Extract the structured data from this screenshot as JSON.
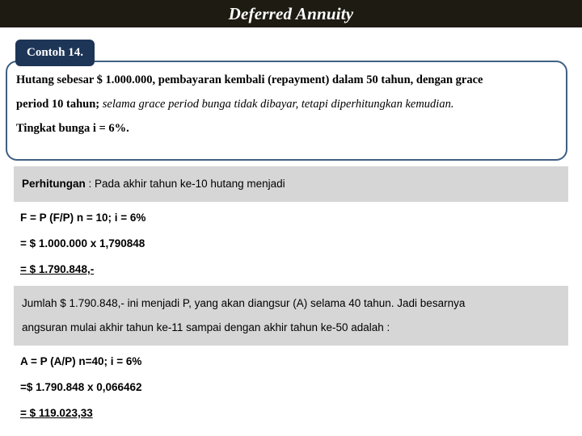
{
  "header": {
    "title": "Deferred Annuity"
  },
  "callout": {
    "tab_label": "Contoh 14.",
    "line1_main": "Hutang sebesar $ 1.000.000, pembayaran kembali (repayment) dalam 50 tahun, dengan grace",
    "line2_bold": "period 10 tahun;",
    "line2_italic": "selama grace period bunga tidak dibayar, tetapi diperhitungkan kemudian.",
    "line3": "Tingkat bunga i = 6%."
  },
  "band1": {
    "label": "Perhitungan",
    "text": " : Pada akhir tahun ke-10 hutang menjadi"
  },
  "formulas1": [
    {
      "text": "F = P (F/P) n = 10; i = 6%",
      "underline": false
    },
    {
      "text": "= $ 1.000.000 x 1,790848",
      "underline": false
    },
    {
      "text": "= $ 1.790.848,-",
      "underline": true
    }
  ],
  "band2": {
    "line1": "Jumlah $ 1.790.848,- ini menjadi P, yang akan diangsur (A) selama 40 tahun. Jadi besarnya",
    "line2": "angsuran mulai akhir tahun ke-11 sampai dengan akhir tahun ke-50 adalah :"
  },
  "formulas2": [
    {
      "text": "A = P (A/P) n=40; i = 6%",
      "underline": false
    },
    {
      "text": "=$ 1.790.848 x 0,066462",
      "underline": false
    },
    {
      "text": "= $ 119.023,33",
      "underline": true
    }
  ],
  "colors": {
    "header_bg": "#1e1b12",
    "tab_bg": "#1d3557",
    "callout_border": "#3f5f82",
    "band_bg": "#d6d6d6",
    "page_bg": "#ffffff",
    "text": "#000000"
  }
}
